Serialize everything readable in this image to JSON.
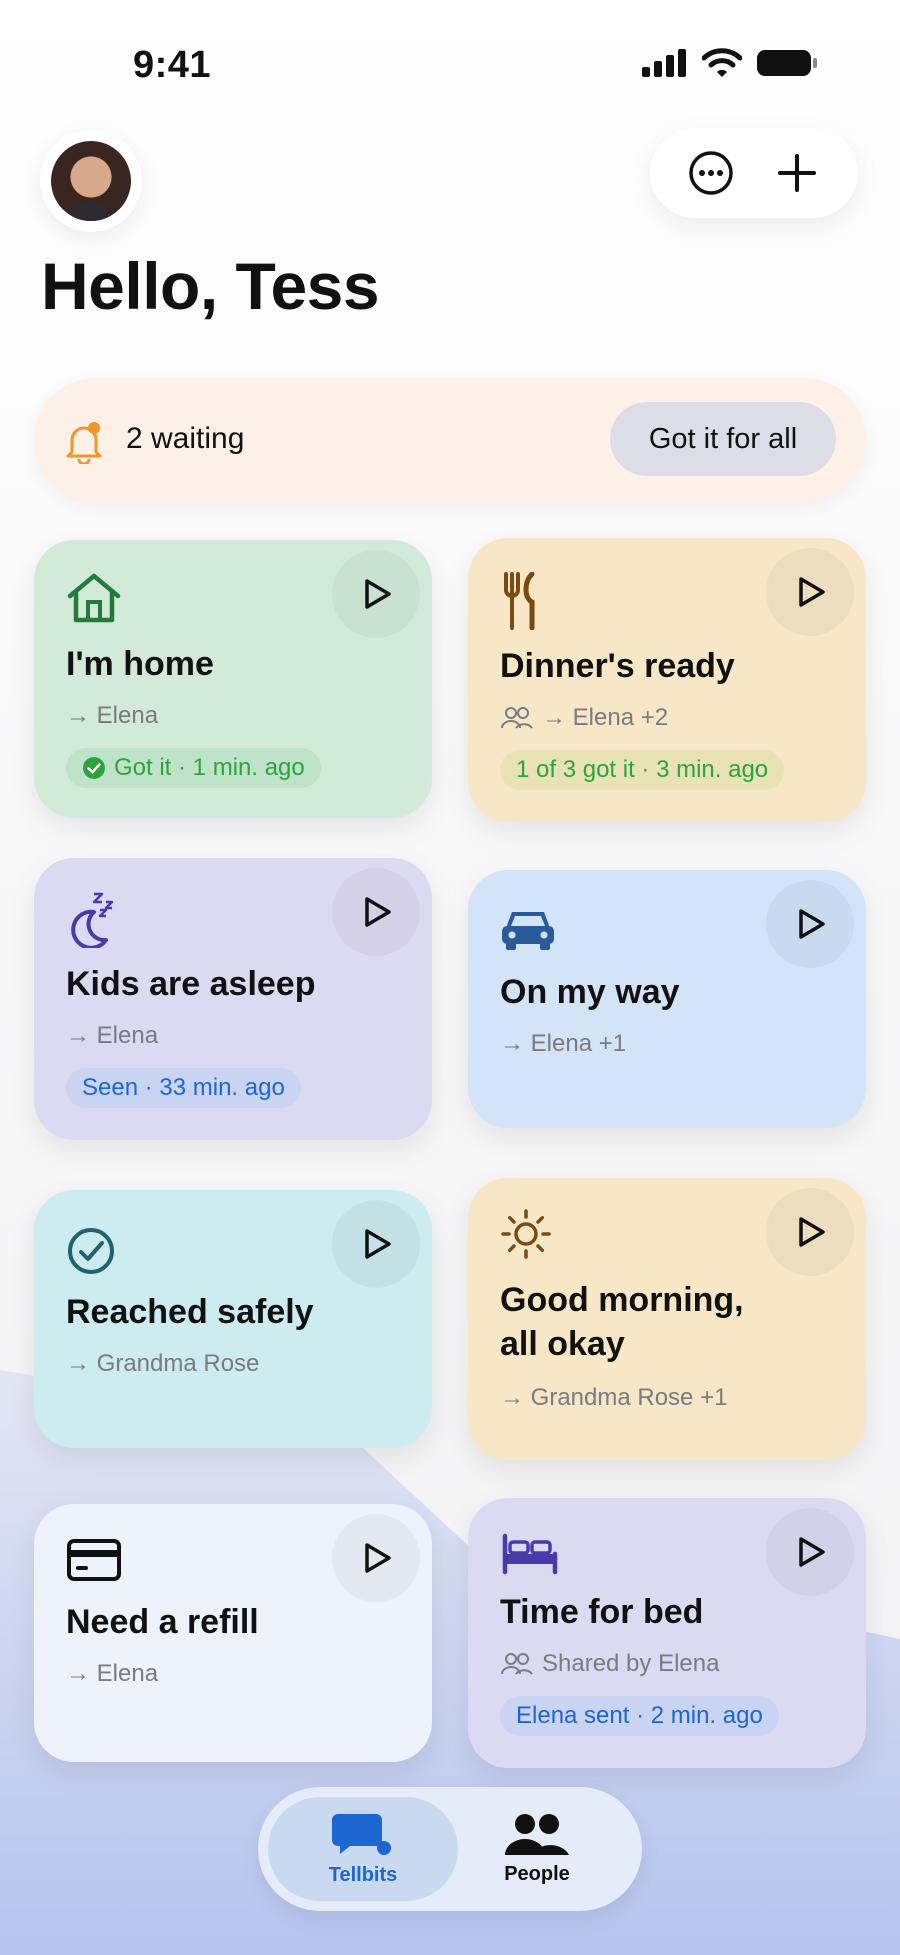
{
  "status_bar": {
    "time": "9:41"
  },
  "header": {
    "greeting": "Hello, Tess"
  },
  "banner": {
    "count_text": "2 waiting",
    "action_label": "Got it for all"
  },
  "cards": [
    {
      "title": "I'm home",
      "recipients": "→ Elena",
      "status": "Got it · 1 min. ago",
      "icon": "house-icon"
    },
    {
      "title": "Dinner's ready",
      "recipients": "→ Elena +2",
      "status": "1 of 3 got it · 3 min. ago",
      "icon": "fork-knife-icon"
    },
    {
      "title": "Kids are asleep",
      "recipients": "→ Elena",
      "status": "Seen · 33 min. ago",
      "icon": "moon-zzz-icon"
    },
    {
      "title": "On my way",
      "recipients": "→ Elena +1",
      "icon": "car-icon"
    },
    {
      "title": "Reached safely",
      "recipients": "→ Grandma Rose",
      "icon": "checkmark-circle-icon"
    },
    {
      "title_line1": "Good morning,",
      "title_line2": "all okay",
      "recipients": "→ Grandma Rose +1",
      "icon": "sun-icon"
    },
    {
      "title": "Need a refill",
      "recipients": "→ Elena",
      "icon": "credit-card-icon"
    },
    {
      "title": "Time for bed",
      "recipients": "Shared by Elena",
      "status": "Elena sent · 2 min. ago",
      "icon": "bed-icon"
    }
  ],
  "tabs": [
    {
      "label": "Tellbits",
      "icon": "chat-bubble-icon",
      "active": true
    },
    {
      "label": "People",
      "icon": "people-icon",
      "active": false
    }
  ],
  "colors": {
    "accent_blue": "#1d66d2",
    "success_green": "#2aa53c",
    "bell_orange": "#f2962b",
    "card_green": "#d2ebd8",
    "card_yellow": "#f7e7c7",
    "card_purple": "#dcd9f2",
    "card_blue": "#d3e3f8",
    "card_teal": "#cdecef"
  }
}
